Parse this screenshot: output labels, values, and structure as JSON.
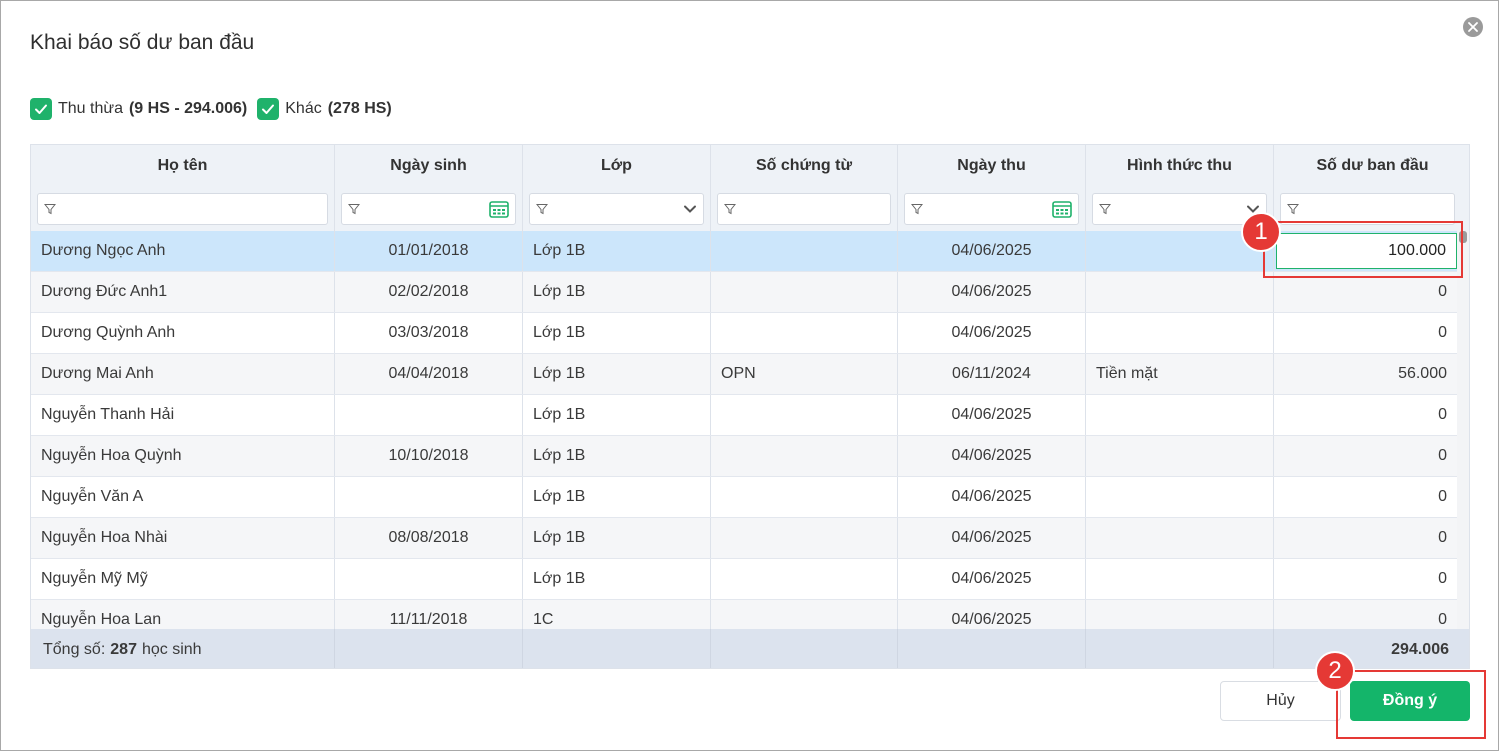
{
  "dialog": {
    "title": "Khai báo số dư ban đầu",
    "close_icon": "close-icon"
  },
  "filters": {
    "thu_thua_label": "Thu thừa",
    "thu_thua_count": "(9 HS - 294.006)",
    "thu_thua_checked": true,
    "khac_label": "Khác",
    "khac_count": "(278 HS)",
    "khac_checked": true
  },
  "table": {
    "columns": [
      "Họ tên",
      "Ngày sinh",
      "Lớp",
      "Số chứng từ",
      "Ngày thu",
      "Hình thức thu",
      "Số dư ban đầu"
    ],
    "rows": [
      {
        "name": "Dương Ngọc Anh",
        "dob": "01/01/2018",
        "class": "Lớp 1B",
        "voucher": "",
        "date": "04/06/2025",
        "method": "",
        "balance": "100.000"
      },
      {
        "name": "Dương Đức Anh1",
        "dob": "02/02/2018",
        "class": "Lớp 1B",
        "voucher": "",
        "date": "04/06/2025",
        "method": "",
        "balance": "0"
      },
      {
        "name": "Dương Quỳnh Anh",
        "dob": "03/03/2018",
        "class": "Lớp 1B",
        "voucher": "",
        "date": "04/06/2025",
        "method": "",
        "balance": "0"
      },
      {
        "name": "Dương Mai Anh",
        "dob": "04/04/2018",
        "class": "Lớp 1B",
        "voucher": "OPN",
        "date": "06/11/2024",
        "method": "Tiền mặt",
        "balance": "56.000"
      },
      {
        "name": "Nguyễn Thanh Hải",
        "dob": "",
        "class": "Lớp 1B",
        "voucher": "",
        "date": "04/06/2025",
        "method": "",
        "balance": "0"
      },
      {
        "name": "Nguyễn Hoa Quỳnh",
        "dob": "10/10/2018",
        "class": "Lớp 1B",
        "voucher": "",
        "date": "04/06/2025",
        "method": "",
        "balance": "0"
      },
      {
        "name": "Nguyễn Văn A",
        "dob": "",
        "class": "Lớp 1B",
        "voucher": "",
        "date": "04/06/2025",
        "method": "",
        "balance": "0"
      },
      {
        "name": "Nguyễn Hoa Nhài",
        "dob": "08/08/2018",
        "class": "Lớp 1B",
        "voucher": "",
        "date": "04/06/2025",
        "method": "",
        "balance": "0"
      },
      {
        "name": "Nguyễn Mỹ Mỹ",
        "dob": "",
        "class": "Lớp 1B",
        "voucher": "",
        "date": "04/06/2025",
        "method": "",
        "balance": "0"
      },
      {
        "name": "Nguyễn Hoa Lan",
        "dob": "11/11/2018",
        "class": "1C",
        "voucher": "",
        "date": "04/06/2025",
        "method": "",
        "balance": "0"
      }
    ],
    "footer": {
      "total_prefix": "Tổng số:",
      "total_count": "287",
      "total_suffix": "học sinh",
      "total_balance": "294.006"
    }
  },
  "buttons": {
    "cancel": "Hủy",
    "ok": "Đồng ý"
  },
  "annotations": {
    "step1": "1",
    "step2": "2",
    "color": "#e53935"
  },
  "colors": {
    "accent": "#14b56a",
    "selected_row": "#cce6fb"
  }
}
